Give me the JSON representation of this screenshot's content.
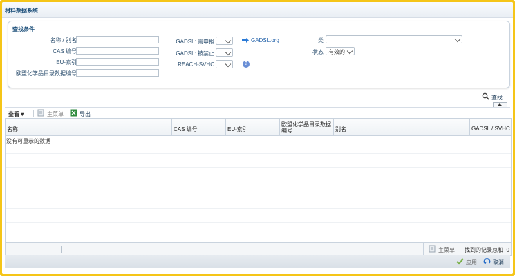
{
  "window": {
    "title": "材料数据系统"
  },
  "search": {
    "header": "查找条件",
    "fields": {
      "name_alias": "名称 / 别名",
      "cas_no": "CAS 编号",
      "eu_index": "EU-索引",
      "einecs_no": "欧盟化学品目录数据编号"
    },
    "gadsl_declare": "GADSL: 需申报",
    "gadsl_prohibited": "GADSL: 被禁止",
    "reach_svhc": "REACH-SVHC",
    "gadsl_link": "GADSL.org",
    "category_label": "类",
    "status_label": "状态",
    "status_value": "有效的",
    "find_button": "查找"
  },
  "toolbar": {
    "view_menu": "查看 ▾",
    "main_menu": "主菜单",
    "export": "导出"
  },
  "table": {
    "columns": [
      "名称",
      "CAS 编号",
      "EU-索引",
      "欧盟化学品目录数据编号",
      "别名",
      "GADSL / SVHC"
    ],
    "empty_message": "没有可显示的数据"
  },
  "footer": {
    "main_menu": "主菜单",
    "records_found_label": "找到的记录总和",
    "records_found_value": "0"
  },
  "actions": {
    "apply": "应用",
    "cancel": "取消"
  },
  "colors": {
    "frame": "#f5c518",
    "title_text": "#1c4f7a",
    "link": "#1f5fa8"
  }
}
